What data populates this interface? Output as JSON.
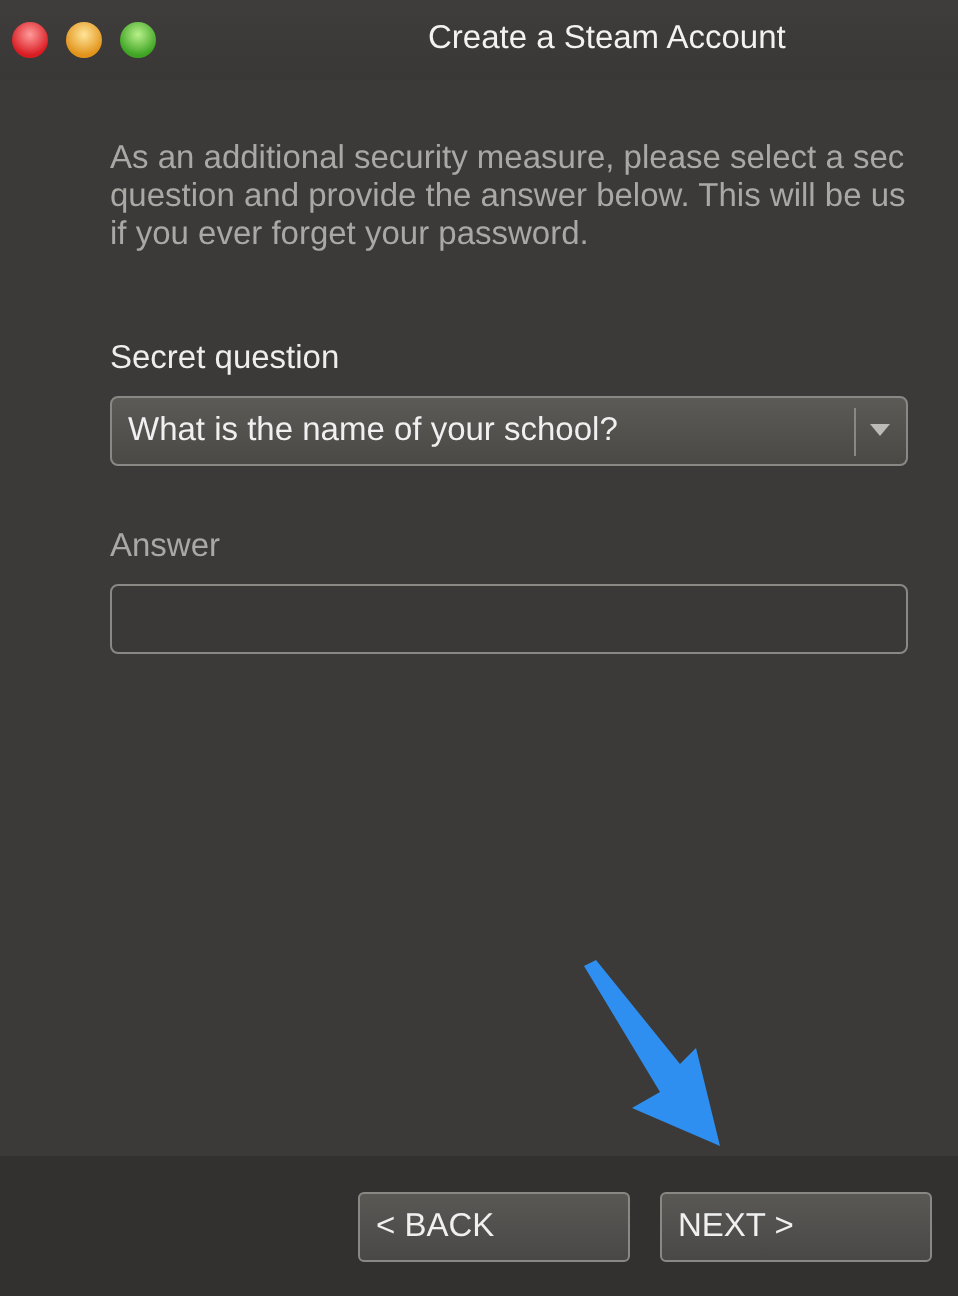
{
  "window": {
    "title": "Create a Steam Account"
  },
  "intro_lines": [
    "As an additional security measure, please select a sec",
    "question and provide the answer below. This will be us",
    "if you ever forget your password."
  ],
  "secret_question": {
    "label": "Secret question",
    "value": "What is the name of your school?"
  },
  "answer": {
    "label": "Answer"
  },
  "back_button": {
    "label": "< BACK"
  },
  "next_button": {
    "label": "NEXT >"
  }
}
